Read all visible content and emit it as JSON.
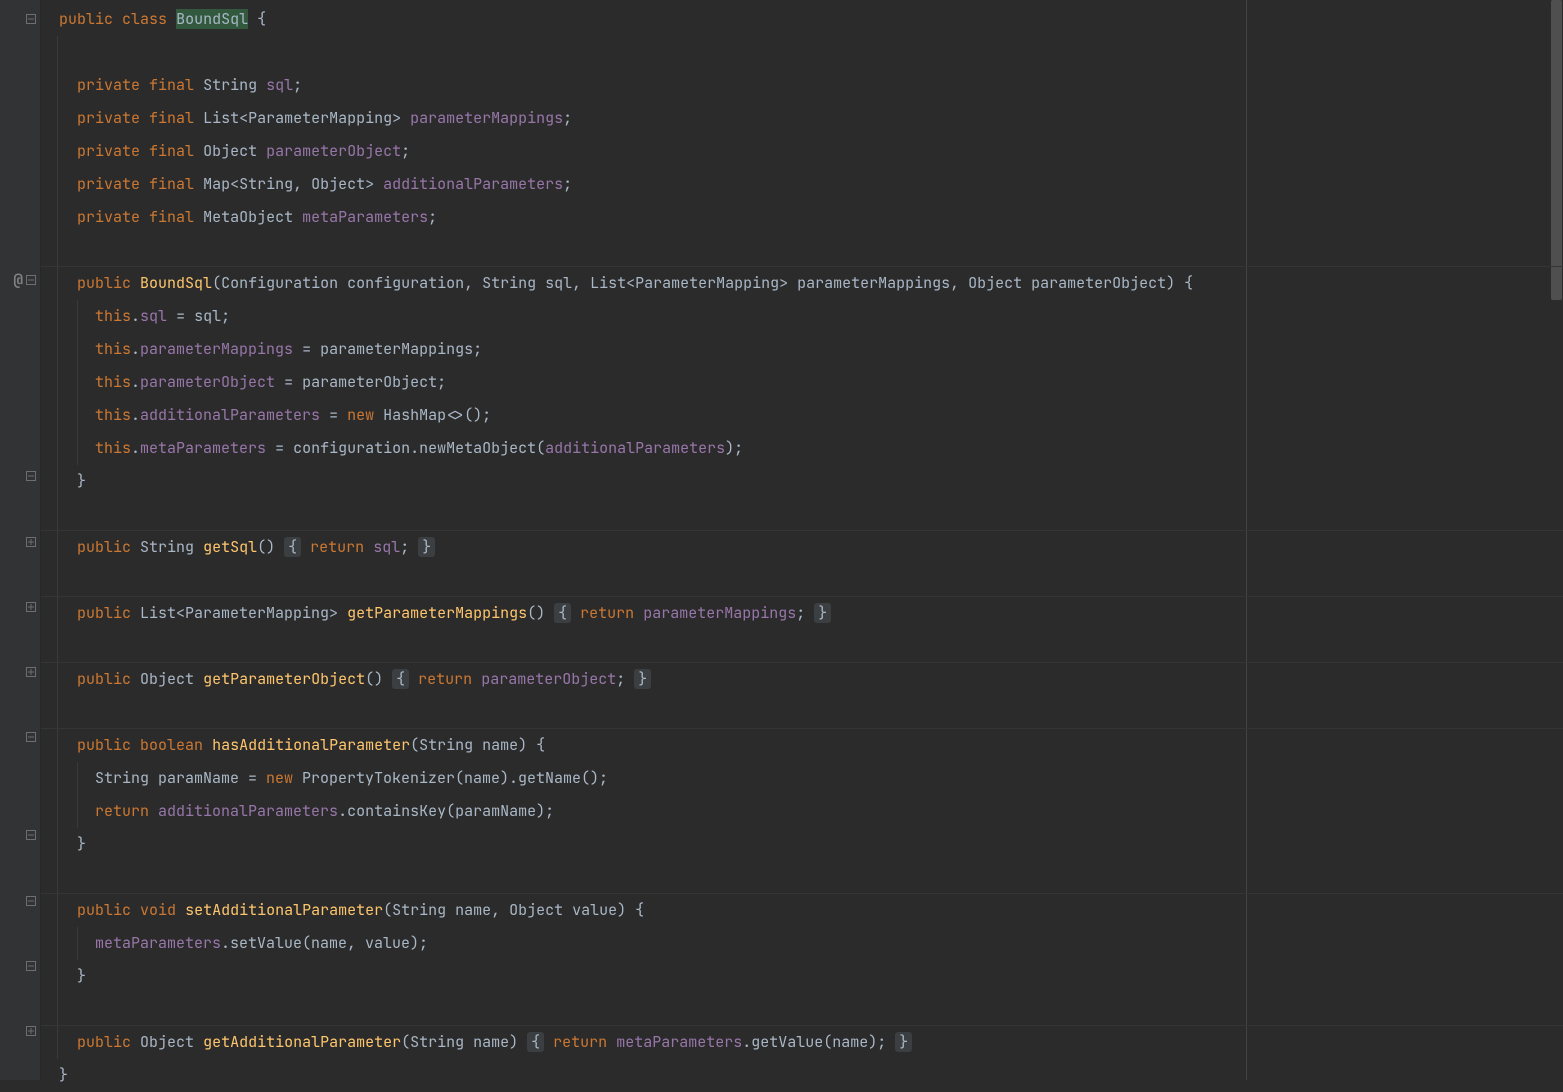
{
  "gutter": {
    "vcs_marker": "@",
    "fold_minus_title": "collapse",
    "fold_plus_title": "expand"
  },
  "code": {
    "l1": {
      "pub": "public",
      "cls": "class",
      "name": "BoundSql",
      "brace": "{"
    },
    "l3": {
      "priv": "private",
      "fin": "final",
      "t": "String",
      "f": "sql",
      "semi": ";"
    },
    "l4": {
      "priv": "private",
      "fin": "final",
      "t": "List<ParameterMapping>",
      "f": "parameterMappings",
      "semi": ";"
    },
    "l5": {
      "priv": "private",
      "fin": "final",
      "t": "Object",
      "f": "parameterObject",
      "semi": ";"
    },
    "l6": {
      "priv": "private",
      "fin": "final",
      "t": "Map<String, Object>",
      "f": "additionalParameters",
      "semi": ";"
    },
    "l7": {
      "priv": "private",
      "fin": "final",
      "t": "MetaObject",
      "f": "metaParameters",
      "semi": ";"
    },
    "l9": {
      "pub": "public",
      "ctor": "BoundSql",
      "sig": "(Configuration configuration, String sql, List<ParameterMapping> parameterMappings, Object parameterObject) {"
    },
    "l10": {
      "th": "this",
      "dot": ".",
      "f": "sql",
      "assign": " = sql;"
    },
    "l11": {
      "th": "this",
      "dot": ".",
      "f": "parameterMappings",
      "assign": " = parameterMappings;"
    },
    "l12": {
      "th": "this",
      "dot": ".",
      "f": "parameterObject",
      "assign": " = parameterObject;"
    },
    "l13": {
      "th": "this",
      "dot": ".",
      "f": "additionalParameters",
      "assign1": " = ",
      "new": "new",
      "assign2": " HashMap<>();"
    },
    "l14": {
      "th": "this",
      "dot": ".",
      "f": "metaParameters",
      "assign1": " = configuration.newMetaObject(",
      "arg": "additionalParameters",
      "assign2": ");"
    },
    "l15": {
      "cb": "}"
    },
    "l17": {
      "pub": "public",
      "t": "String",
      "fn": "getSql",
      "p": "()",
      "ob": "{",
      "ret": "return",
      "val": "sql",
      "semi": ";",
      "cb": "}"
    },
    "l19": {
      "pub": "public",
      "t": "List<ParameterMapping>",
      "fn": "getParameterMappings",
      "p": "()",
      "ob": "{",
      "ret": "return",
      "val": "parameterMappings",
      "semi": ";",
      "cb": "}"
    },
    "l21": {
      "pub": "public",
      "t": "Object",
      "fn": "getParameterObject",
      "p": "()",
      "ob": "{",
      "ret": "return",
      "val": "parameterObject",
      "semi": ";",
      "cb": "}"
    },
    "l23": {
      "pub": "public",
      "bool": "boolean",
      "fn": "hasAdditionalParameter",
      "sig": "(String name) {"
    },
    "l24": {
      "txt1": "String paramName = ",
      "new": "new",
      "txt2": " PropertyTokenizer(name).getName();"
    },
    "l25": {
      "ret": "return",
      "sp": " ",
      "f": "additionalParameters",
      "call": ".containsKey(paramName);"
    },
    "l26": {
      "cb": "}"
    },
    "l28": {
      "pub": "public",
      "void": "void",
      "fn": "setAdditionalParameter",
      "sig": "(String name, Object value) {"
    },
    "l29": {
      "f": "metaParameters",
      "call": ".setValue(name, value);"
    },
    "l30": {
      "cb": "}"
    },
    "l32": {
      "pub": "public",
      "t": "Object",
      "fn": "getAdditionalParameter",
      "sig": "(String name)",
      "ob": "{",
      "ret": "return",
      "f": "metaParameters",
      "call": ".getValue(name);",
      "cb": "}"
    },
    "l33": {
      "cb": "}"
    }
  },
  "colors": {
    "keyword": "#cc7832",
    "function": "#ffc66d",
    "field": "#9876aa",
    "text": "#a9b7c6",
    "selection": "#32593d",
    "foldedBg": "#3c3f41"
  }
}
